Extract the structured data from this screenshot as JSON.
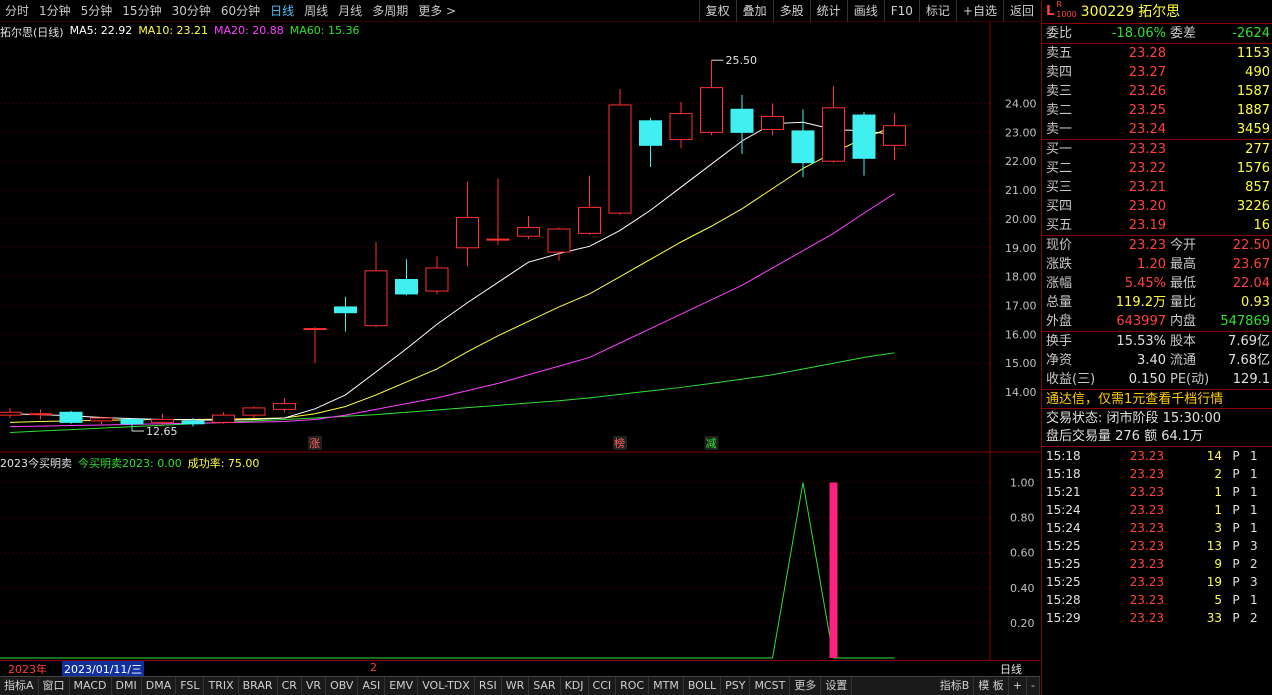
{
  "toolbar": {
    "periods": [
      "分时",
      "1分钟",
      "5分钟",
      "15分钟",
      "30分钟",
      "60分钟",
      "日线",
      "周线",
      "月线",
      "多周期",
      "更多 >"
    ],
    "active_index": 6,
    "buttons": [
      "复权",
      "叠加",
      "多股",
      "统计",
      "画线",
      "F10",
      "标记",
      "+自选",
      "返回"
    ]
  },
  "main_legend": {
    "title": "拓尔思(日线)",
    "ma5": "MA5: 22.92",
    "ma10": "MA10: 23.21",
    "ma20": "MA20: 20.88",
    "ma60": "MA60: 15.36"
  },
  "sub_legend": {
    "title": "2023今买明卖",
    "value": "今买明卖2023: 0.00",
    "rate": "成功率: 75.00"
  },
  "colors": {
    "up": "#ff3030",
    "down": "#40f0f0",
    "ma5": "#ffffff",
    "ma10": "#ffff40",
    "ma20": "#ff40ff",
    "ma60": "#30e030",
    "signal_bar": "#ff2080"
  },
  "chart_data": {
    "type": "candlestick",
    "ylim": [
      12.2,
      26.2
    ],
    "yticks": [
      "24.00",
      "23.00",
      "22.00",
      "21.00",
      "20.00",
      "19.00",
      "18.00",
      "17.00",
      "16.00",
      "15.00",
      "14.00"
    ],
    "candles": [
      {
        "o": 13.2,
        "c": 13.3,
        "h": 13.45,
        "l": 13.1
      },
      {
        "o": 13.25,
        "c": 13.25,
        "h": 13.4,
        "l": 13.05
      },
      {
        "o": 13.3,
        "c": 12.95,
        "h": 13.35,
        "l": 12.9
      },
      {
        "o": 13.0,
        "c": 13.1,
        "h": 13.15,
        "l": 12.85
      },
      {
        "o": 13.05,
        "c": 12.9,
        "h": 13.1,
        "l": 12.65
      },
      {
        "o": 12.95,
        "c": 13.05,
        "h": 13.25,
        "l": 12.85
      },
      {
        "o": 13.0,
        "c": 12.9,
        "h": 13.1,
        "l": 12.8
      },
      {
        "o": 12.95,
        "c": 13.2,
        "h": 13.3,
        "l": 12.9
      },
      {
        "o": 13.2,
        "c": 13.45,
        "h": 13.5,
        "l": 13.1
      },
      {
        "o": 13.4,
        "c": 13.6,
        "h": 13.8,
        "l": 13.3
      },
      {
        "o": 16.2,
        "c": 16.2,
        "h": 16.25,
        "l": 15.0
      },
      {
        "o": 16.95,
        "c": 16.75,
        "h": 17.3,
        "l": 16.1
      },
      {
        "o": 16.3,
        "c": 18.2,
        "h": 19.2,
        "l": 16.25
      },
      {
        "o": 17.9,
        "c": 17.4,
        "h": 18.6,
        "l": 17.35
      },
      {
        "o": 17.5,
        "c": 18.3,
        "h": 18.7,
        "l": 17.4
      },
      {
        "o": 19.0,
        "c": 20.05,
        "h": 21.3,
        "l": 18.35
      },
      {
        "o": 19.3,
        "c": 19.3,
        "h": 21.4,
        "l": 19.1
      },
      {
        "o": 19.4,
        "c": 19.7,
        "h": 20.1,
        "l": 19.3
      },
      {
        "o": 18.85,
        "c": 19.65,
        "h": 19.7,
        "l": 18.55
      },
      {
        "o": 19.5,
        "c": 20.4,
        "h": 21.5,
        "l": 19.45
      },
      {
        "o": 20.2,
        "c": 23.95,
        "h": 24.5,
        "l": 20.15
      },
      {
        "o": 23.4,
        "c": 22.55,
        "h": 23.5,
        "l": 21.8
      },
      {
        "o": 22.75,
        "c": 23.65,
        "h": 24.05,
        "l": 22.45
      },
      {
        "o": 23.0,
        "c": 24.55,
        "h": 25.5,
        "l": 22.9
      },
      {
        "o": 23.8,
        "c": 23.0,
        "h": 24.3,
        "l": 22.25
      },
      {
        "o": 23.1,
        "c": 23.55,
        "h": 24.0,
        "l": 22.9
      },
      {
        "o": 23.05,
        "c": 21.95,
        "h": 23.8,
        "l": 21.45
      },
      {
        "o": 22.0,
        "c": 23.85,
        "h": 24.6,
        "l": 21.95
      },
      {
        "o": 23.6,
        "c": 22.1,
        "h": 23.7,
        "l": 21.5
      },
      {
        "o": 22.55,
        "c": 23.23,
        "h": 23.67,
        "l": 22.04
      }
    ],
    "ma5": [
      13.25,
      13.22,
      13.18,
      13.12,
      13.08,
      13.05,
      13.04,
      13.02,
      13.05,
      13.1,
      13.42,
      13.9,
      14.7,
      15.5,
      16.35,
      17.1,
      17.8,
      18.5,
      18.8,
      19.05,
      19.6,
      20.3,
      21.1,
      21.9,
      22.7,
      23.3,
      23.35,
      23.1,
      23.05,
      22.92
    ],
    "ma10": [
      12.95,
      12.98,
      13.0,
      13.02,
      13.04,
      13.05,
      13.05,
      13.06,
      13.08,
      13.1,
      13.25,
      13.5,
      13.9,
      14.35,
      14.8,
      15.4,
      15.95,
      16.45,
      16.95,
      17.4,
      18.0,
      18.6,
      19.2,
      19.75,
      20.35,
      21.05,
      21.75,
      22.3,
      22.8,
      23.21
    ],
    "ma20": [
      12.8,
      12.82,
      12.84,
      12.86,
      12.88,
      12.9,
      12.92,
      12.94,
      12.96,
      12.98,
      13.05,
      13.2,
      13.4,
      13.6,
      13.8,
      14.05,
      14.3,
      14.6,
      14.9,
      15.2,
      15.7,
      16.2,
      16.7,
      17.2,
      17.7,
      18.3,
      18.9,
      19.5,
      20.2,
      20.88
    ],
    "ma60": [
      12.6,
      12.65,
      12.7,
      12.75,
      12.8,
      12.85,
      12.9,
      12.95,
      13.0,
      13.05,
      13.1,
      13.16,
      13.22,
      13.3,
      13.38,
      13.46,
      13.54,
      13.62,
      13.7,
      13.8,
      13.92,
      14.04,
      14.16,
      14.3,
      14.45,
      14.6,
      14.8,
      15.0,
      15.2,
      15.36
    ],
    "annotations": {
      "high": "25.50",
      "low": "12.65"
    },
    "markers": [
      {
        "index": 10,
        "text": "涨"
      },
      {
        "index": 20,
        "text": "榜"
      },
      {
        "index": 23,
        "text": "减"
      }
    ],
    "indicator": {
      "ylim": [
        0,
        1.1
      ],
      "yticks": [
        "1.00",
        "0.80",
        "0.60",
        "0.40",
        "0.20"
      ],
      "line": [
        0,
        0,
        0,
        0,
        0,
        0,
        0,
        0,
        0,
        0,
        0,
        0,
        0,
        0,
        0,
        0,
        0,
        0,
        0,
        0,
        0,
        0,
        0,
        0,
        0,
        0,
        1,
        0,
        0,
        0
      ],
      "bars": [
        {
          "index": 27,
          "value": 1.0
        }
      ]
    }
  },
  "date_bar": {
    "year": "2023年",
    "cursor_date": "2023/01/11/三",
    "month": "2"
  },
  "bottom_tabs": [
    "指标A",
    "窗口",
    "MACD",
    "DMI",
    "DMA",
    "FSL",
    "TRIX",
    "BRAR",
    "CR",
    "VR",
    "OBV",
    "ASI",
    "EMV",
    "VOL-TDX",
    "RSI",
    "WR",
    "SAR",
    "KDJ",
    "CCI",
    "ROC",
    "MTM",
    "BOLL",
    "PSY",
    "MCST",
    "更多",
    "设置"
  ],
  "bottom_right": {
    "a": "指标B",
    "b": "模 板",
    "c": "+",
    "d": "-",
    "period": "日线"
  },
  "panel": {
    "code": "300229",
    "name": "拓尔思",
    "weibi_label": "委比",
    "weibi": "-18.06%",
    "weicha_label": "委差",
    "weicha": "-2624",
    "asks": [
      {
        "label": "卖五",
        "price": "23.28",
        "vol": "1153"
      },
      {
        "label": "卖四",
        "price": "23.27",
        "vol": "490"
      },
      {
        "label": "卖三",
        "price": "23.26",
        "vol": "1587"
      },
      {
        "label": "卖二",
        "price": "23.25",
        "vol": "1887"
      },
      {
        "label": "卖一",
        "price": "23.24",
        "vol": "3459"
      }
    ],
    "bids": [
      {
        "label": "买一",
        "price": "23.23",
        "vol": "277"
      },
      {
        "label": "买二",
        "price": "23.22",
        "vol": "1576"
      },
      {
        "label": "买三",
        "price": "23.21",
        "vol": "857"
      },
      {
        "label": "买四",
        "price": "23.20",
        "vol": "3226"
      },
      {
        "label": "买五",
        "price": "23.19",
        "vol": "16"
      }
    ],
    "stats": [
      {
        "l1": "现价",
        "v1": "23.23",
        "c1": "red",
        "l2": "今开",
        "v2": "22.50",
        "c2": "red"
      },
      {
        "l1": "涨跌",
        "v1": "1.20",
        "c1": "red",
        "l2": "最高",
        "v2": "23.67",
        "c2": "red"
      },
      {
        "l1": "涨幅",
        "v1": "5.45%",
        "c1": "red",
        "l2": "最低",
        "v2": "22.04",
        "c2": "red"
      },
      {
        "l1": "总量",
        "v1": "119.2万",
        "c1": "yellow",
        "l2": "量比",
        "v2": "0.93",
        "c2": "yellow"
      },
      {
        "l1": "外盘",
        "v1": "643997",
        "c1": "red",
        "l2": "内盘",
        "v2": "547869",
        "c2": "green"
      }
    ],
    "stats2": [
      {
        "l1": "换手",
        "v1": "15.53%",
        "l2": "股本",
        "v2": "7.69亿"
      },
      {
        "l1": "净资",
        "v1": "3.40",
        "l2": "流通",
        "v2": "7.68亿"
      },
      {
        "l1": "收益(三)",
        "v1": "0.150",
        "l2": "PE(动)",
        "v2": "129.1"
      }
    ],
    "promo": "通达信，仅需1元查看千档行情",
    "trade_status": "交易状态: 闭市阶段 15:30:00",
    "after_hours": "盘后交易量 276 额 64.1万",
    "ticks": [
      {
        "t": "15:18",
        "p": "23.23",
        "v": "14",
        "f": "P",
        "n": "1"
      },
      {
        "t": "15:18",
        "p": "23.23",
        "v": "2",
        "f": "P",
        "n": "1"
      },
      {
        "t": "15:21",
        "p": "23.23",
        "v": "1",
        "f": "P",
        "n": "1"
      },
      {
        "t": "15:24",
        "p": "23.23",
        "v": "1",
        "f": "P",
        "n": "1"
      },
      {
        "t": "15:24",
        "p": "23.23",
        "v": "3",
        "f": "P",
        "n": "1"
      },
      {
        "t": "15:25",
        "p": "23.23",
        "v": "13",
        "f": "P",
        "n": "3"
      },
      {
        "t": "15:25",
        "p": "23.23",
        "v": "9",
        "f": "P",
        "n": "2"
      },
      {
        "t": "15:25",
        "p": "23.23",
        "v": "19",
        "f": "P",
        "n": "3"
      },
      {
        "t": "15:28",
        "p": "23.23",
        "v": "5",
        "f": "P",
        "n": "1"
      },
      {
        "t": "15:29",
        "p": "23.23",
        "v": "33",
        "f": "P",
        "n": "2"
      }
    ]
  }
}
